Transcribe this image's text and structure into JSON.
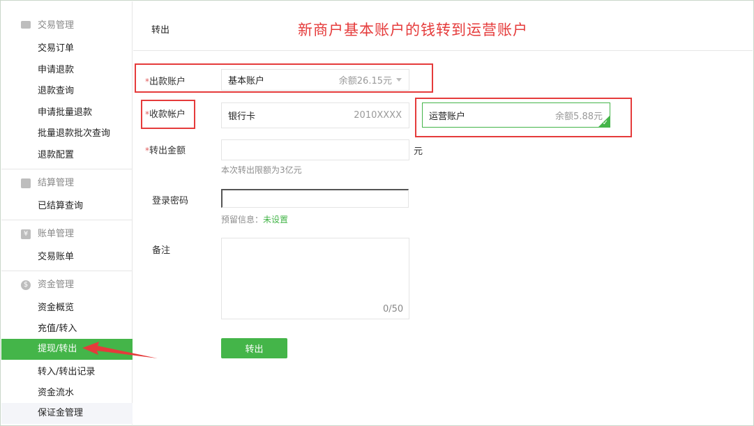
{
  "annotation": "新商户基本账户的钱转到运营账户",
  "sidebar": {
    "groups": [
      {
        "title": "交易管理",
        "icon": "card-icon",
        "items": [
          "交易订单",
          "申请退款",
          "退款查询",
          "申请批量退款",
          "批量退款批次查询",
          "退款配置"
        ]
      },
      {
        "title": "结算管理",
        "icon": "grid-icon",
        "items": [
          "已结算查询"
        ]
      },
      {
        "title": "账单管理",
        "icon": "yuan-bill-icon",
        "items": [
          "交易账单"
        ]
      },
      {
        "title": "资金管理",
        "icon": "money-bag-icon",
        "items": [
          "资金概览",
          "充值/转入",
          "提现/转出",
          "转入/转出记录",
          "资金流水",
          "保证金管理"
        ]
      }
    ],
    "active_item": "提现/转出"
  },
  "page": {
    "title": "转出"
  },
  "form": {
    "from_account": {
      "label": "出款账户",
      "value": "基本账户",
      "balance": "余额26.15元"
    },
    "to_account": {
      "label": "收款帐户",
      "option_bank": {
        "name": "银行卡",
        "number": "2010XXXX"
      },
      "option_ops": {
        "name": "运营账户",
        "balance": "余额5.88元",
        "selected": true
      }
    },
    "amount": {
      "label": "转出金额",
      "value": "",
      "unit": "元",
      "hint": "本次转出限额为3亿元"
    },
    "password": {
      "label": "登录密码",
      "value": "",
      "hint_prefix": "预留信息：",
      "hint_status": "未设置"
    },
    "remark": {
      "label": "备注",
      "value": "",
      "counter": "0/50"
    },
    "submit_label": "转出"
  },
  "colors": {
    "accent": "#44b549",
    "annotation": "#e53b3b",
    "required_star": "#e15f5f"
  }
}
